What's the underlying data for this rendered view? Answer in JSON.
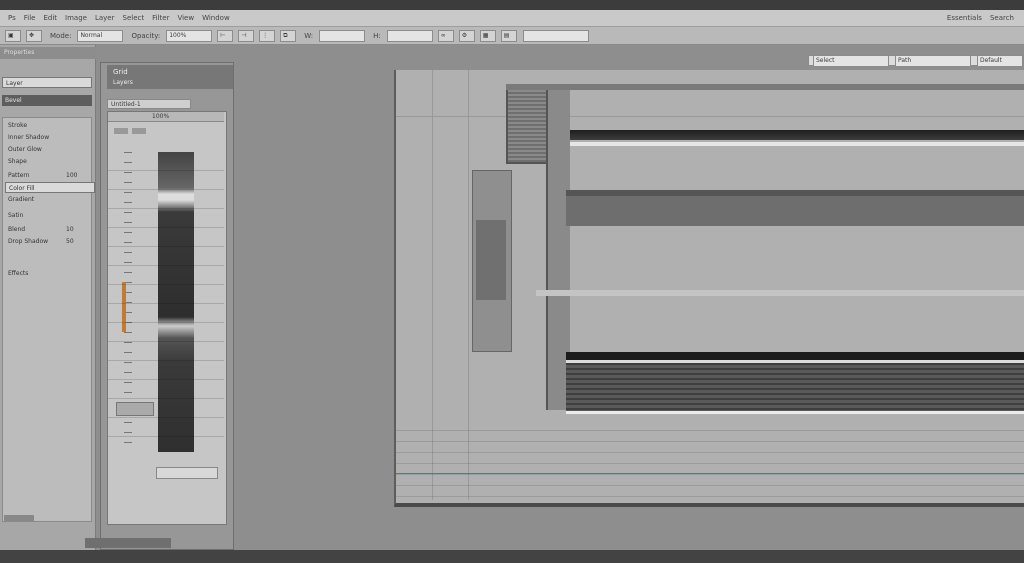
{
  "app": {
    "title": ""
  },
  "menubar": {
    "items": [
      "Ps",
      "File",
      "Edit",
      "Image",
      "Layer",
      "Select",
      "Filter",
      "View",
      "Window"
    ],
    "right_items": [
      "Essentials",
      "Search"
    ]
  },
  "toolbar": {
    "mode_label": "Mode:",
    "mode_value": "Normal",
    "opacity_label": "Opacity:",
    "opacity_value": "100%",
    "width_label": "W:",
    "height_label": "H:"
  },
  "left_panel": {
    "title": "Properties",
    "rows": [
      "Layer",
      "Bevel",
      "Stroke",
      "Inner Shadow",
      "Outer Glow",
      "Shape",
      "Pattern",
      "Color Fill",
      "Gradient",
      "Satin",
      "Blend",
      "Drop Shadow",
      "Effects"
    ],
    "values": [
      "100",
      "50",
      "10"
    ]
  },
  "mid_panel": {
    "title": "Grid",
    "subtitle": "Layers",
    "doc_title": "Untitled-1",
    "zoom": "100%"
  },
  "right_toolbar": {
    "field1": "Select",
    "field2": "Path",
    "field3": "Default"
  },
  "colors": {
    "accent": "#c94a4a",
    "panel": "#a7a7a7",
    "canvas": "#b0b0b0"
  }
}
